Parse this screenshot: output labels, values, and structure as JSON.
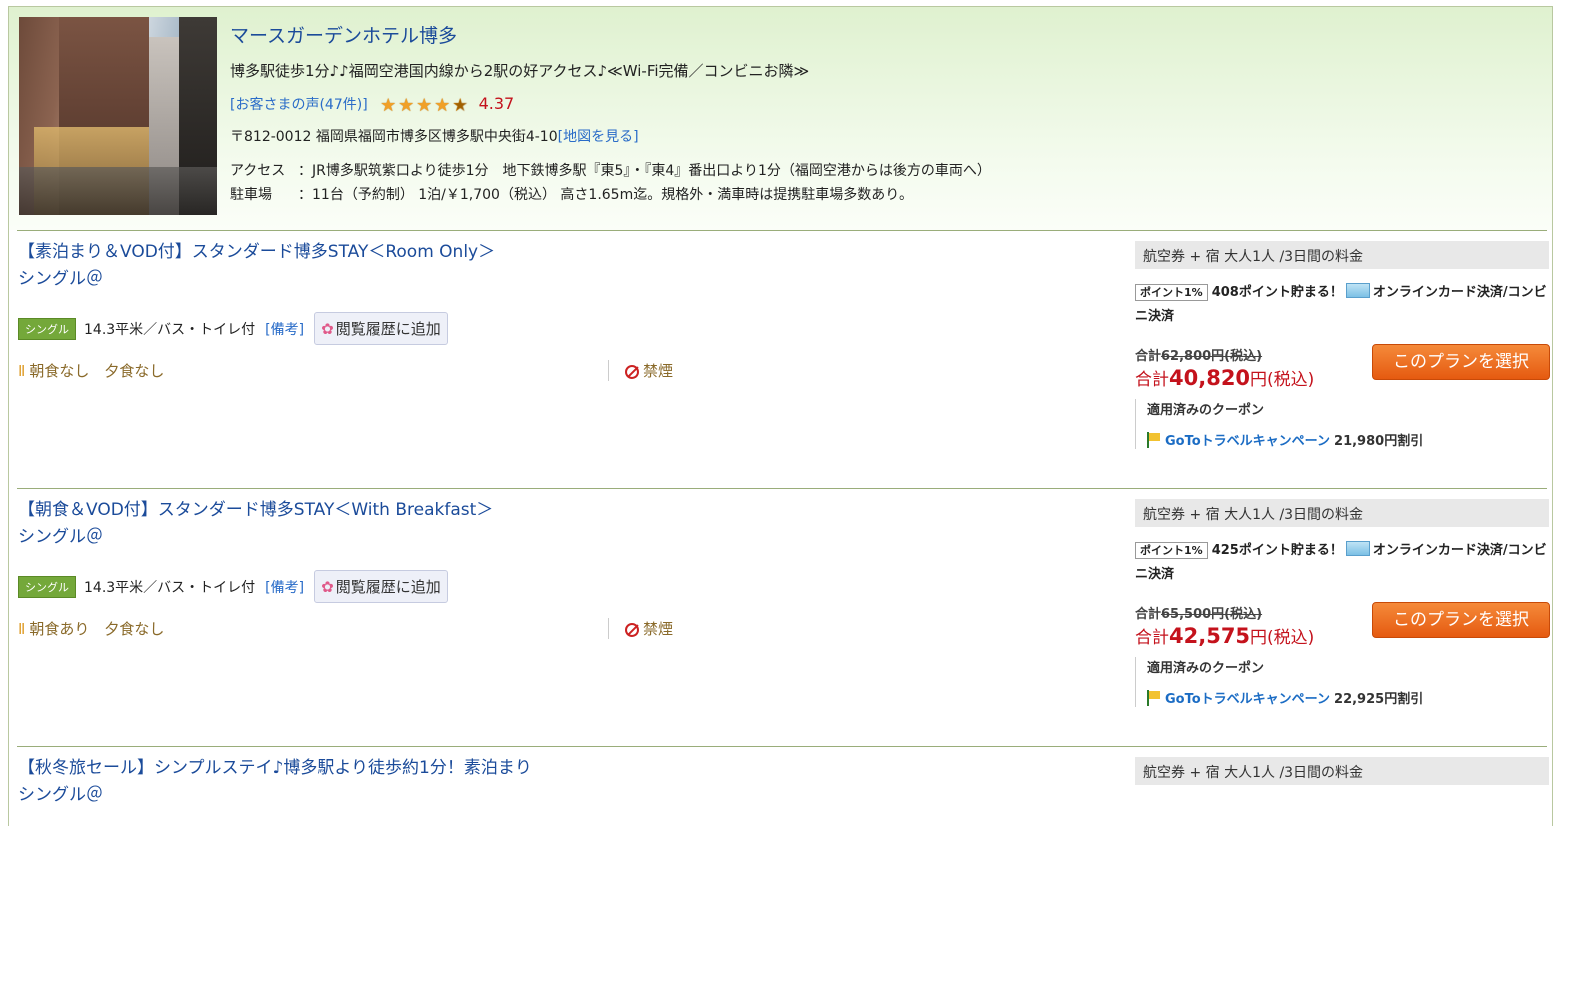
{
  "hotel": {
    "name": "マースガーデンホテル博多",
    "catchcopy": "博多駅徒歩1分♪♪福岡空港国内線から2駅の好アクセス♪≪Wi-Fi完備／コンビニお隣≫",
    "review_link": "[お客さまの声(47件)]",
    "rating": "4.37",
    "stars": 4.5,
    "address": "〒812-0012 福岡県福岡市博多区博多駅中央街4-10",
    "map_link": "[地図を見る]",
    "access_label": "アクセス",
    "access_text": "：JR博多駅筑紫口より徒歩1分　地下鉄博多駅『東5』・『東4』番出口より1分（福岡空港からは後方の車両へ）",
    "parking_label": "駐車場",
    "parking_text": "：11台（予約制） 1泊/￥1,700（税込） 高さ1.65m迄。規格外・満車時は提携駐車場多数あり。"
  },
  "plans": [
    {
      "title": "【素泊まり＆VOD付】スタンダード博多STAY＜Room Only＞",
      "room": "シングル＠",
      "badge": "シングル",
      "room_info": "14.3平米／バス・トイレ付",
      "remarks": "[備考]",
      "history_btn": "閲覧履歴に追加",
      "meal": "朝食なし　夕食なし",
      "smoking": "禁煙",
      "price_header": "航空券 + 宿 大人1人 /3日間の料金",
      "point_badge": "ポイント1%",
      "points_text": "408ポイント貯まる！",
      "payment": "オンラインカード決済/コンビニ決済",
      "orig_label": "合計",
      "orig_price": "62,800円(税込)",
      "total_label": "合計",
      "total_price": "40,820",
      "total_suffix": "円(税込)",
      "select_btn": "このプランを選択",
      "coupon_head": "適用済みのクーポン",
      "coupon_name": "GoToトラベルキャンペーン",
      "coupon_discount": "21,980円割引"
    },
    {
      "title": "【朝食＆VOD付】スタンダード博多STAY＜With Breakfast＞",
      "room": "シングル＠",
      "badge": "シングル",
      "room_info": "14.3平米／バス・トイレ付",
      "remarks": "[備考]",
      "history_btn": "閲覧履歴に追加",
      "meal": "朝食あり　夕食なし",
      "smoking": "禁煙",
      "price_header": "航空券 + 宿 大人1人 /3日間の料金",
      "point_badge": "ポイント1%",
      "points_text": "425ポイント貯まる！",
      "payment": "オンラインカード決済/コンビニ決済",
      "orig_label": "合計",
      "orig_price": "65,500円(税込)",
      "total_label": "合計",
      "total_price": "42,575",
      "total_suffix": "円(税込)",
      "select_btn": "このプランを選択",
      "coupon_head": "適用済みのクーポン",
      "coupon_name": "GoToトラベルキャンペーン",
      "coupon_discount": "22,925円割引"
    },
    {
      "title": "【秋冬旅セール】シンプルステイ♪博多駅より徒歩約1分！素泊まり",
      "room": "シングル＠",
      "price_header": "航空券 + 宿 大人1人 /3日間の料金"
    }
  ]
}
